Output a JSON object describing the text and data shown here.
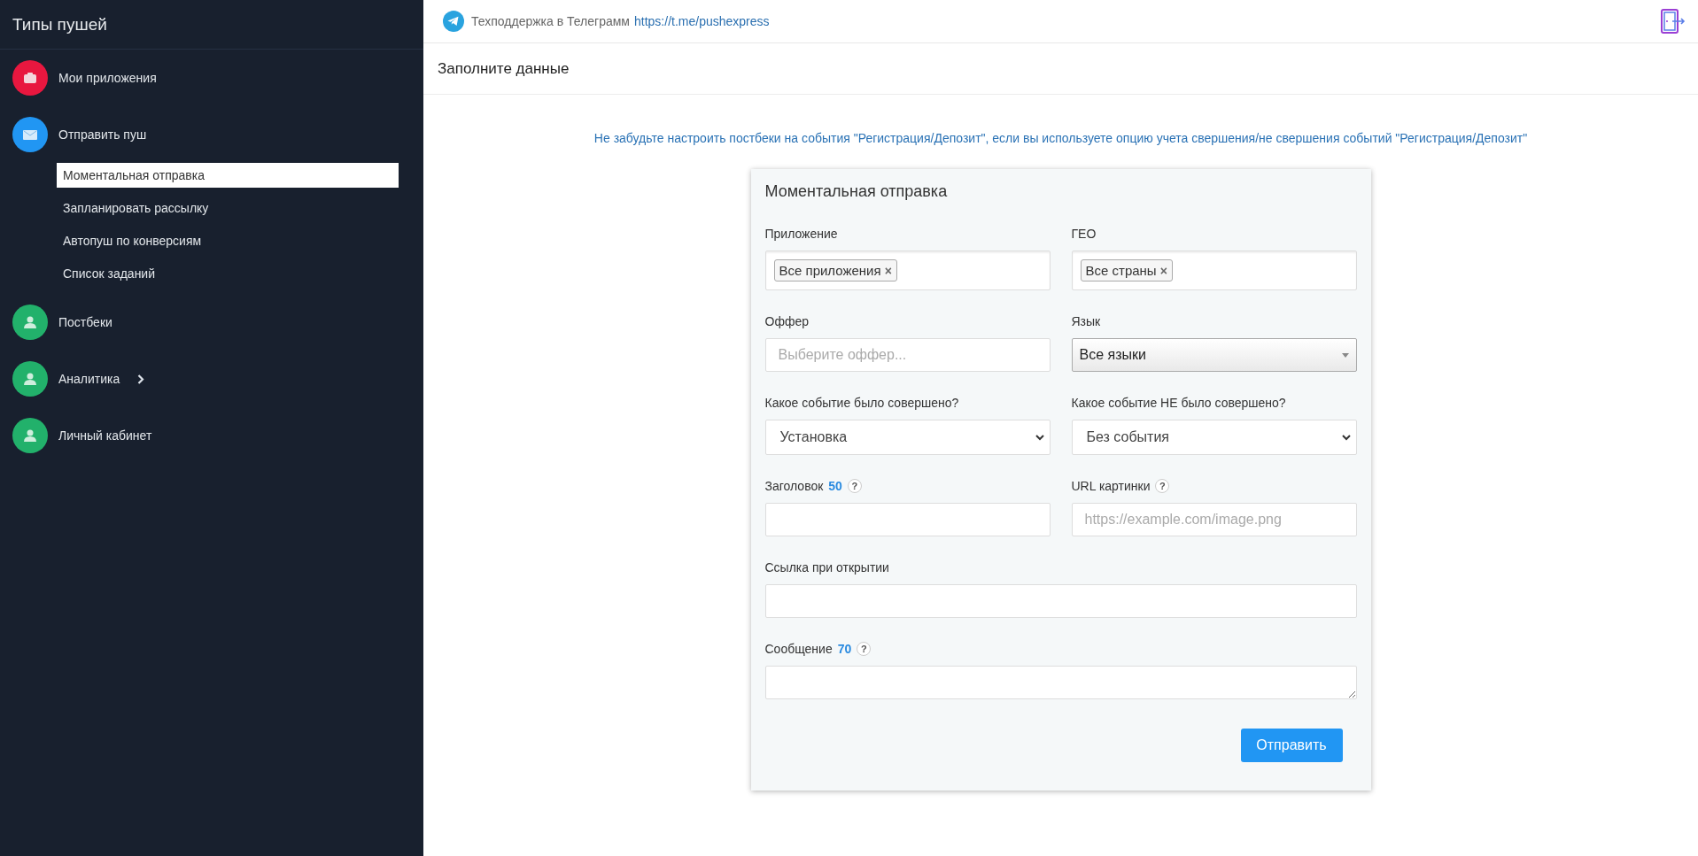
{
  "sidebar": {
    "title": "Типы пушей",
    "items": [
      {
        "label": "Мои приложения",
        "color": "#e8173f",
        "kind": "link"
      },
      {
        "label": "Отправить пуш",
        "color": "#2196f3",
        "kind": "group",
        "children": [
          {
            "label": "Моментальная отправка",
            "selected": true
          },
          {
            "label": "Запланировать рассылку",
            "selected": false
          },
          {
            "label": "Автопуш по конверсиям",
            "selected": false
          },
          {
            "label": "Список заданий",
            "selected": false
          }
        ]
      },
      {
        "label": "Постбеки",
        "color": "#22b16b",
        "kind": "link"
      },
      {
        "label": "Аналитика",
        "color": "#22b16b",
        "kind": "expandable"
      },
      {
        "label": "Личный кабинет",
        "color": "#22b16b",
        "kind": "link"
      }
    ]
  },
  "topbar": {
    "support_text": "Техподдержка в Телеграмм",
    "support_link": "https://t.me/pushexpress"
  },
  "page_title": "Заполните данные",
  "notice": "Не забудьте настроить постбеки на события \"Регистрация/Депозит\", если вы используете опцию учета свершения/не свершения событий \"Регистрация/Депозит\"",
  "form": {
    "title": "Моментальная отправка",
    "rows": [
      [
        {
          "label": "Приложение",
          "kind": "tags",
          "tags": [
            "Все приложения"
          ],
          "remove": "×"
        },
        {
          "label": "ГЕО",
          "kind": "tags",
          "tags": [
            "Все страны"
          ],
          "remove": "×"
        }
      ],
      [
        {
          "label": "Оффер",
          "kind": "text",
          "placeholder": "Выберите оффер..."
        },
        {
          "label": "Язык",
          "kind": "dropdown",
          "value": "Все языки"
        }
      ],
      [
        {
          "label": "Какое событие было совершено?",
          "kind": "select",
          "value": "Установка"
        },
        {
          "label": "Какое событие НЕ было совершено?",
          "kind": "select",
          "value": "Без события"
        }
      ],
      [
        {
          "label": "Заголовок",
          "counter": "50",
          "help": "?",
          "kind": "text"
        },
        {
          "label": "URL картинки",
          "help": "?",
          "kind": "text",
          "placeholder": "https://example.com/image.png"
        }
      ],
      [
        {
          "label": "Ссылка при открытии",
          "kind": "text"
        }
      ],
      [
        {
          "label": "Сообщение",
          "counter": "70",
          "help": "?",
          "kind": "textarea"
        }
      ]
    ],
    "submit": "Отправить"
  }
}
